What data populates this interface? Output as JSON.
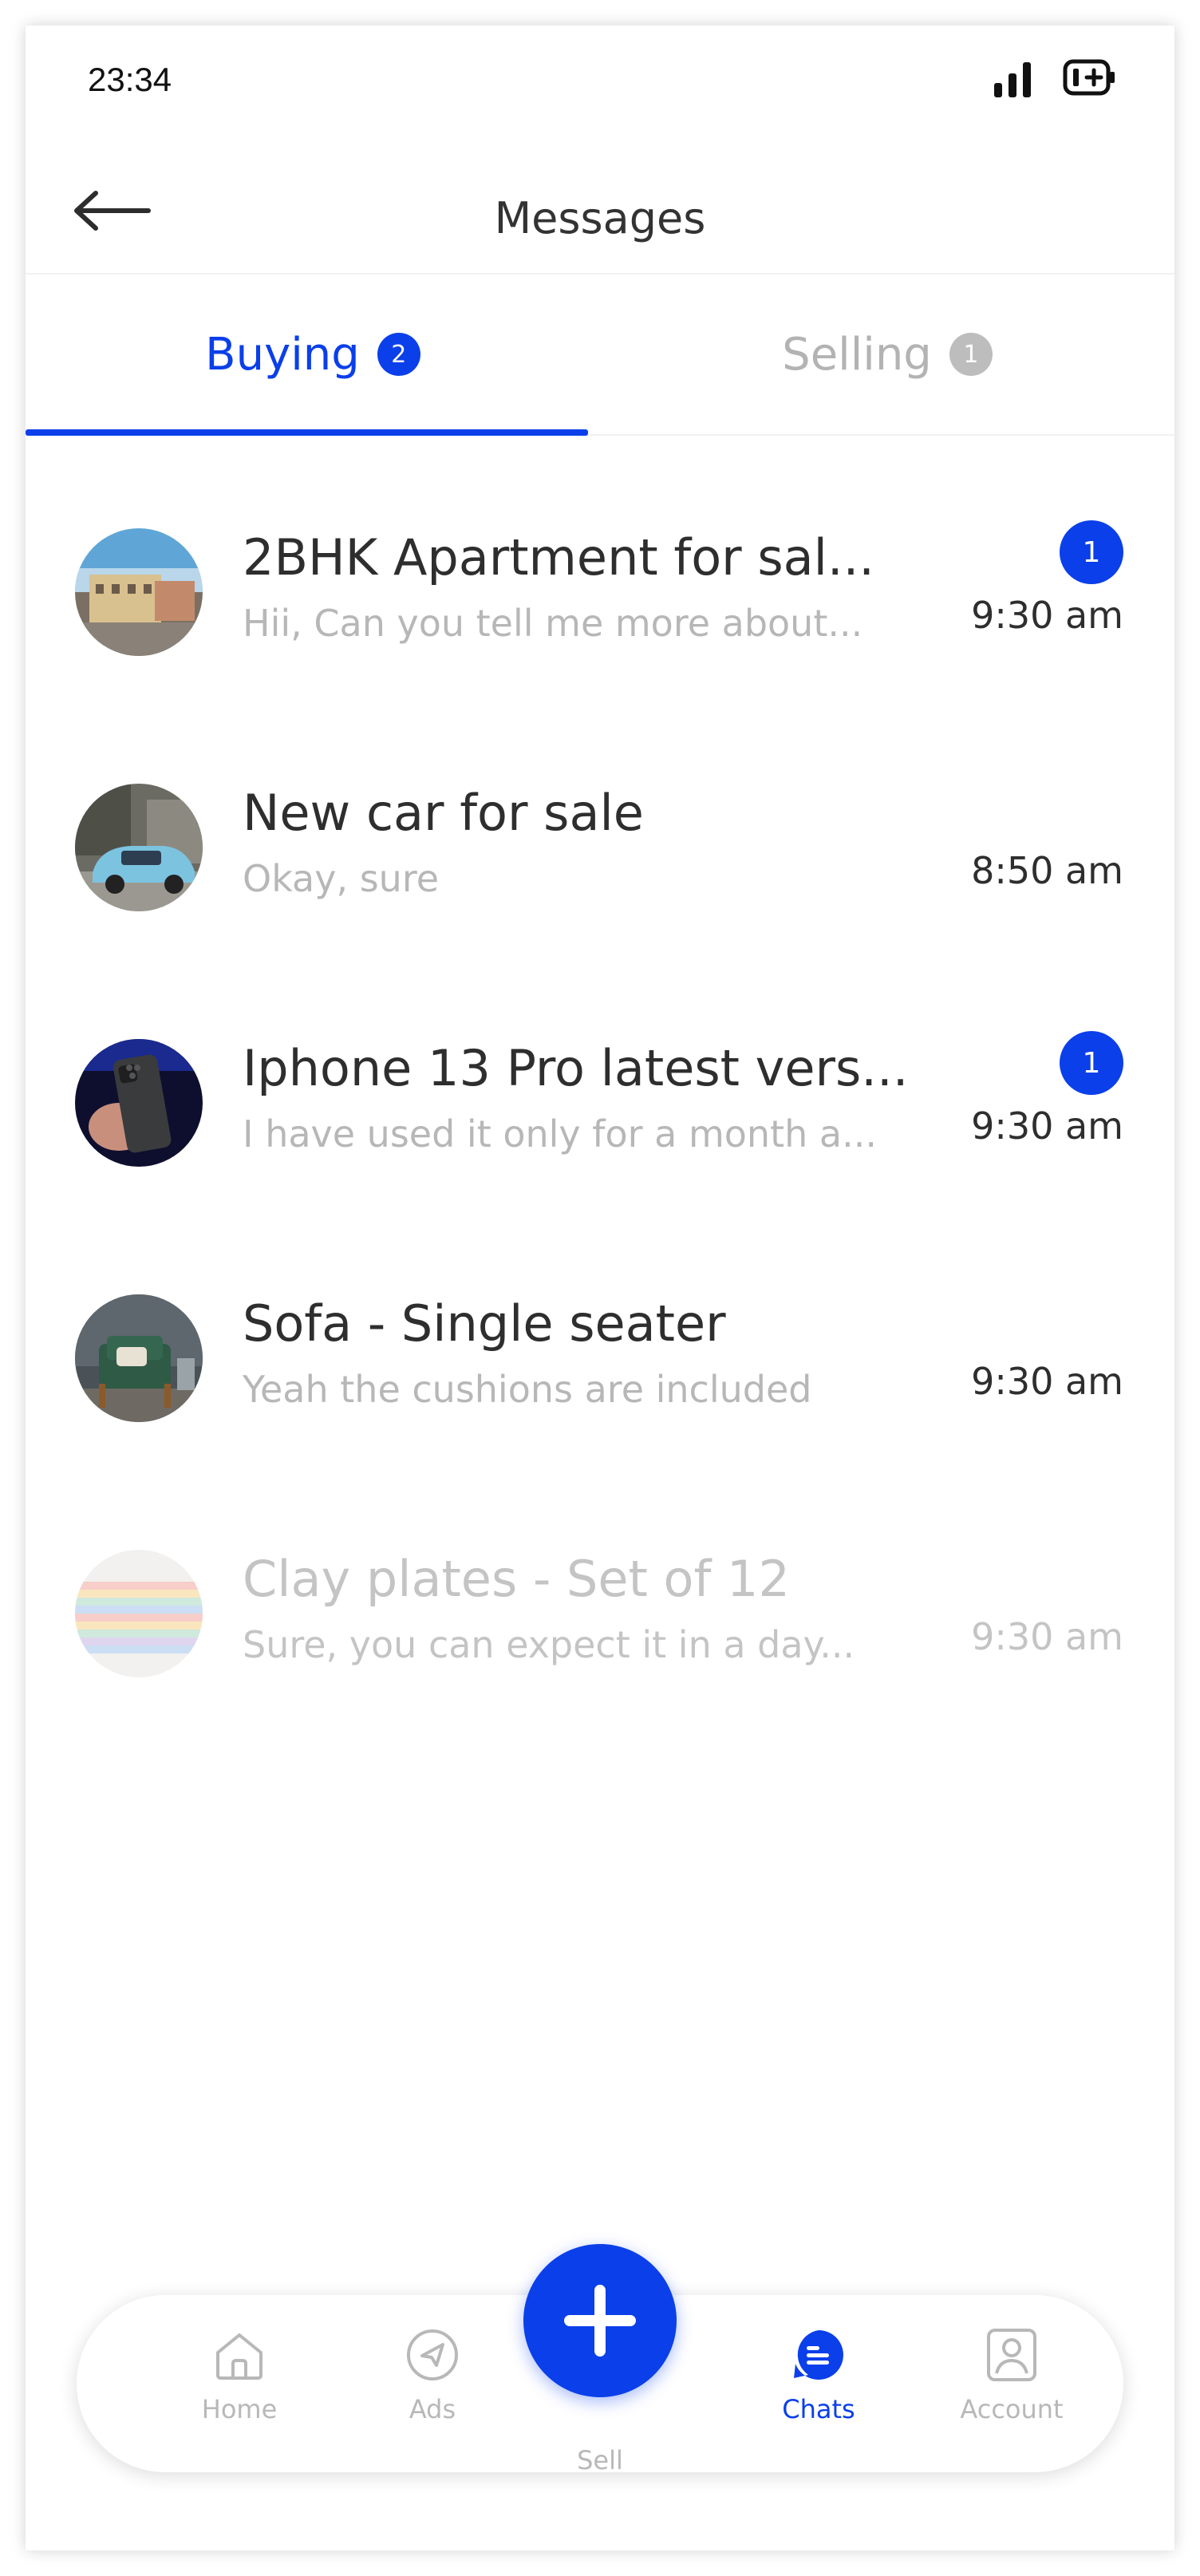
{
  "status_bar": {
    "time": "23:34"
  },
  "header": {
    "title": "Messages"
  },
  "tabs": [
    {
      "label": "Buying",
      "badge": "2",
      "active": true
    },
    {
      "label": "Selling",
      "badge": "1",
      "active": false
    }
  ],
  "chats": [
    {
      "title": "2BHK Apartment for sal...",
      "preview": "Hii, Can you tell me more about...",
      "time": "9:30 am",
      "unread": "1",
      "avatar": "apartment-photo"
    },
    {
      "title": "New car for sale",
      "preview": "Okay, sure",
      "time": "8:50 am",
      "unread": "",
      "avatar": "car-photo"
    },
    {
      "title": "Iphone 13 Pro latest vers...",
      "preview": "I have used it only for a month a...",
      "time": "9:30 am",
      "unread": "1",
      "avatar": "phone-photo"
    },
    {
      "title": "Sofa - Single seater",
      "preview": "Yeah the cushions are included",
      "time": "9:30 am",
      "unread": "",
      "avatar": "sofa-photo"
    },
    {
      "title": "Clay plates - Set of 12",
      "preview": "Sure, you can expect it in a day...",
      "time": "9:30 am",
      "unread": "",
      "avatar": "plates-photo",
      "dimmed": true
    }
  ],
  "bottom_nav": {
    "items": [
      {
        "label": "Home",
        "icon": "home-icon"
      },
      {
        "label": "Ads",
        "icon": "send-icon"
      },
      {
        "label": "Sell",
        "icon": "plus-icon"
      },
      {
        "label": "Chats",
        "icon": "chat-icon",
        "active": true
      },
      {
        "label": "Account",
        "icon": "account-icon"
      }
    ]
  },
  "colors": {
    "accent": "#0a3fea",
    "muted": "#b8b8b8",
    "text": "#2e2e2e"
  }
}
